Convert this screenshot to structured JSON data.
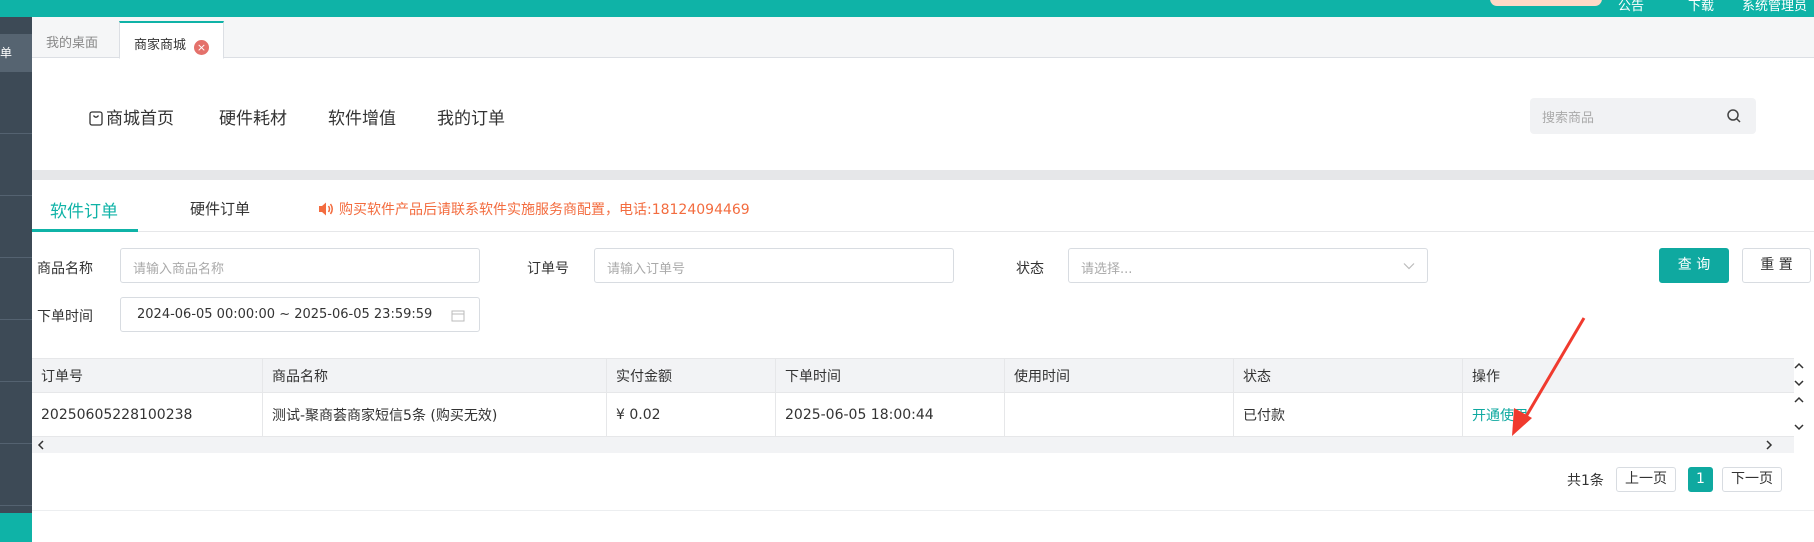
{
  "topbar": {
    "nav": [
      "公告",
      "下载",
      "系统管理员"
    ]
  },
  "sidebar": {
    "selected_label": "单"
  },
  "tabs": [
    {
      "label": "我的桌面"
    },
    {
      "label": "商家商城",
      "close": "×"
    }
  ],
  "mall_nav": {
    "items": [
      "商城首页",
      "硬件耗材",
      "软件增值",
      "我的订单"
    ],
    "search_placeholder": "搜索商品"
  },
  "order_tabs": {
    "items": [
      "软件订单",
      "硬件订单"
    ],
    "notice": "购买软件产品后请联系软件实施服务商配置，电话:18124094469"
  },
  "filters": {
    "product_label": "商品名称",
    "product_placeholder": "请输入商品名称",
    "order_label": "订单号",
    "order_placeholder": "请输入订单号",
    "status_label": "状态",
    "status_placeholder": "请选择...",
    "time_label": "下单时间",
    "time_value": "2024-06-05 00:00:00 ~ 2025-06-05 23:59:59",
    "query_button": "查 询",
    "reset_button": "重 置"
  },
  "table": {
    "columns": [
      "订单号",
      "商品名称",
      "实付金额",
      "下单时间",
      "使用时间",
      "状态",
      "操作"
    ],
    "rows": [
      [
        "20250605228100238",
        "测试-聚商荟商家短信5条 (购买无效)",
        "¥ 0.02",
        "2025-06-05 18:00:44",
        "",
        "已付款",
        "开通使用"
      ]
    ]
  },
  "pagination": {
    "total": "共1条",
    "prev": "上一页",
    "current": "1",
    "next": "下一页"
  },
  "colors": {
    "accent": "#0fb3a7",
    "notice": "#f36c3f",
    "annotation_arrow": "#f03a2e"
  }
}
